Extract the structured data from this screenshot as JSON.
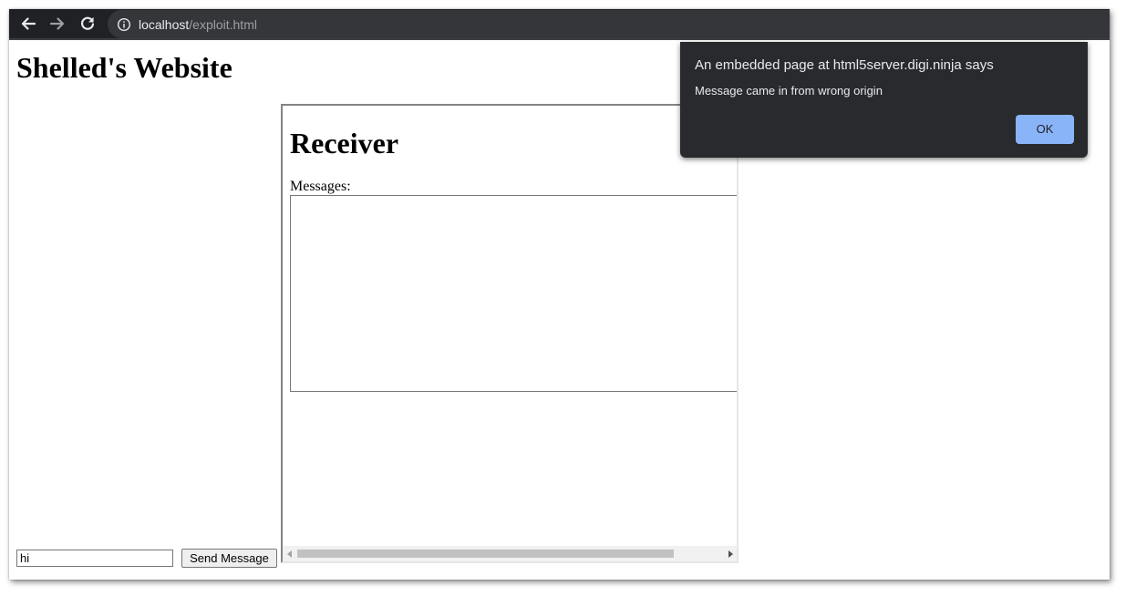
{
  "browser": {
    "url_host": "localhost",
    "url_path": "/exploit.html",
    "icons": {
      "back": "arrow-left-icon",
      "forward": "arrow-right-icon",
      "reload": "reload-icon",
      "site_info": "info-icon"
    },
    "colors": {
      "toolbar": "#202124",
      "omnibox": "#35363a"
    }
  },
  "page": {
    "title": "Shelled's Website",
    "message_input_value": "hi",
    "send_button_label": "Send Message"
  },
  "iframe": {
    "heading": "Receiver",
    "messages_label": "Messages:",
    "messages_content": "",
    "scrollbar_position": 0
  },
  "dialog": {
    "title": "An embedded page at html5server.digi.ninja says",
    "message": "Message came in from wrong origin",
    "ok_label": "OK",
    "colors": {
      "background": "#292a2d",
      "button": "#8ab4f8"
    }
  }
}
